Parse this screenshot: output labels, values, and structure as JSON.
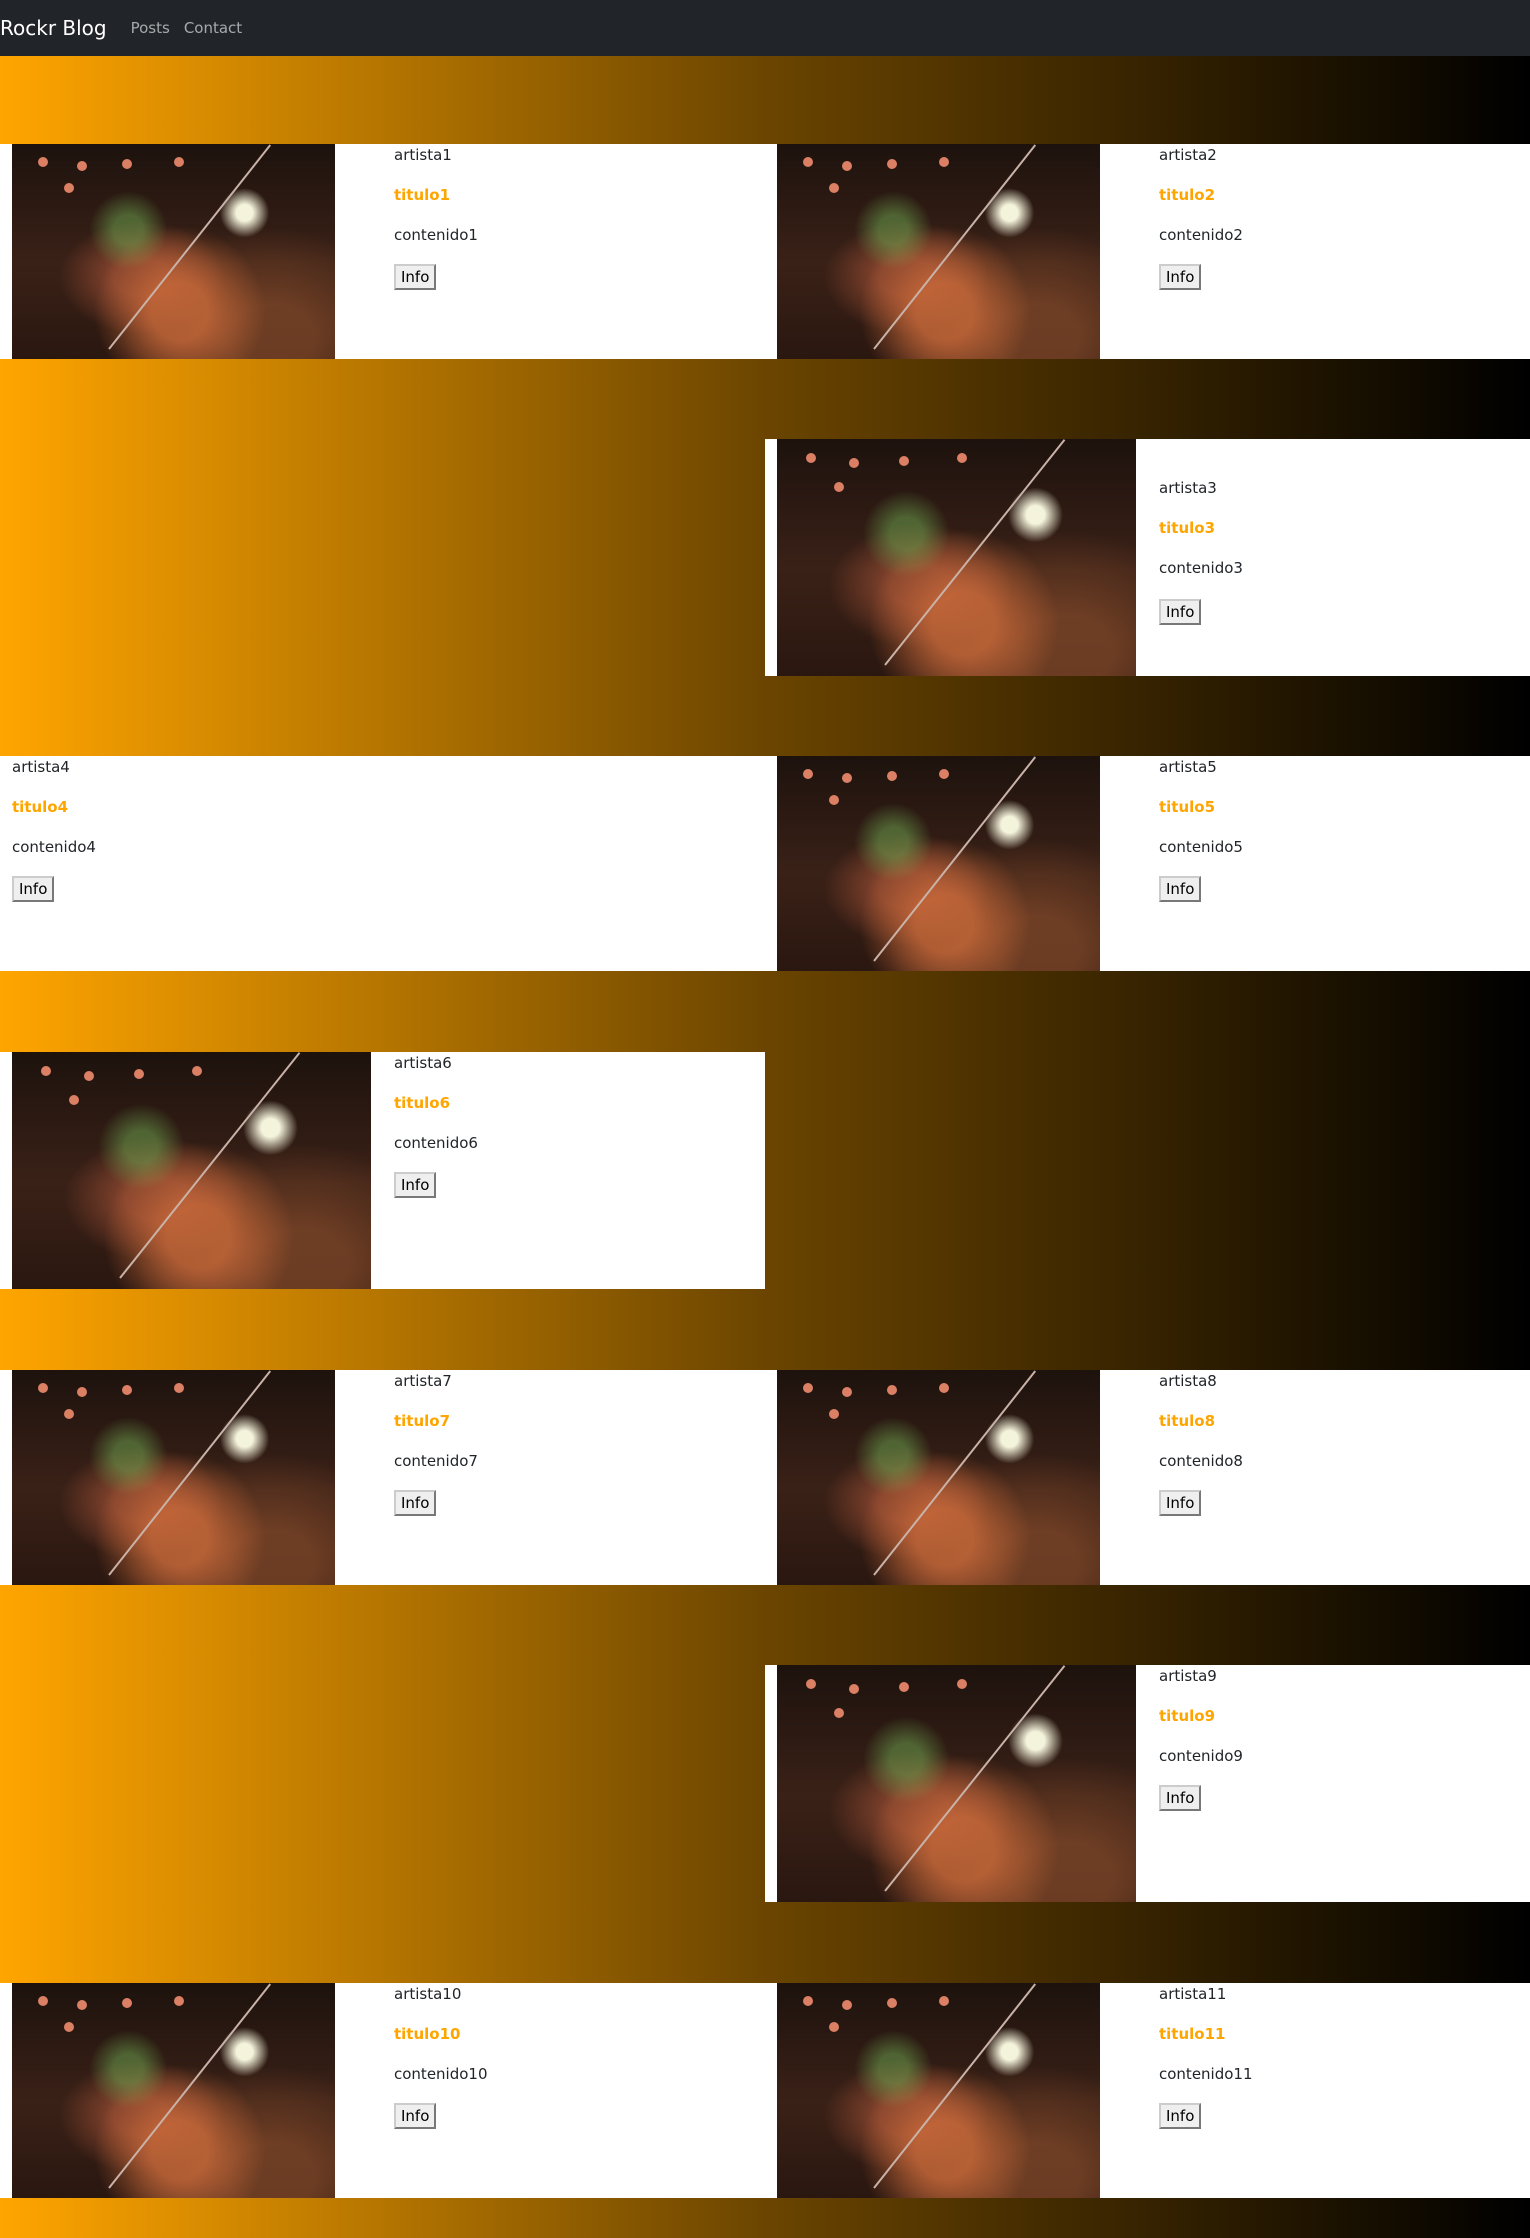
{
  "nav": {
    "brand": "Rockr Blog",
    "links": [
      "Posts",
      "Contact"
    ]
  },
  "posts": [
    {
      "artist": "artista1",
      "title": "titulo1",
      "content": "contenido1",
      "button": "Info"
    },
    {
      "artist": "artista2",
      "title": "titulo2",
      "content": "contenido2",
      "button": "Info"
    },
    {
      "artist": "artista3",
      "title": "titulo3",
      "content": "contenido3",
      "button": "Info"
    },
    {
      "artist": "artista4",
      "title": "titulo4",
      "content": "contenido4",
      "button": "Info"
    },
    {
      "artist": "artista5",
      "title": "titulo5",
      "content": "contenido5",
      "button": "Info"
    },
    {
      "artist": "artista6",
      "title": "titulo6",
      "content": "contenido6",
      "button": "Info"
    },
    {
      "artist": "artista7",
      "title": "titulo7",
      "content": "contenido7",
      "button": "Info"
    },
    {
      "artist": "artista8",
      "title": "titulo8",
      "content": "contenido8",
      "button": "Info"
    },
    {
      "artist": "artista9",
      "title": "titulo9",
      "content": "contenido9",
      "button": "Info"
    },
    {
      "artist": "artista10",
      "title": "titulo10",
      "content": "contenido10",
      "button": "Info"
    },
    {
      "artist": "artista11",
      "title": "titulo11",
      "content": "contenido11",
      "button": "Info"
    }
  ],
  "colors": {
    "navbar": "#212529",
    "accent": "#ffa500",
    "gradient_start": "#ffa500",
    "gradient_end": "#000000"
  }
}
